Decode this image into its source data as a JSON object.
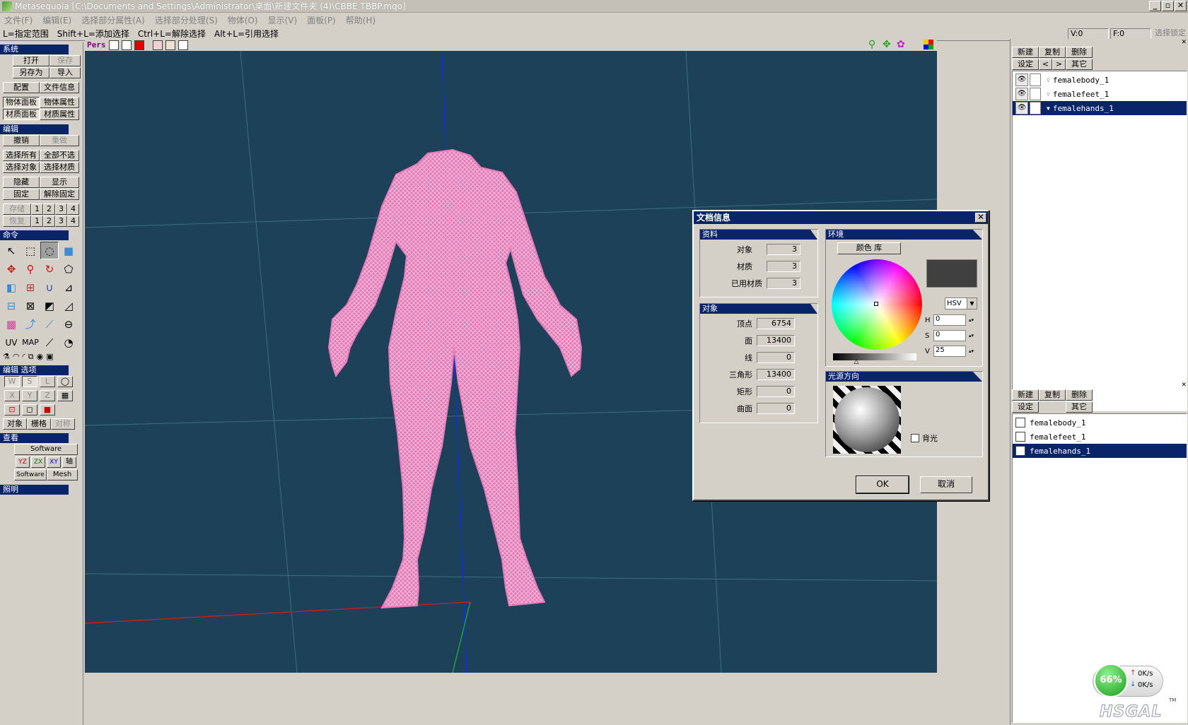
{
  "window": {
    "title": "Metasequoia [C:\\Documents and Settings\\Administrator\\桌面\\新建文件夹 (4)\\CBBE TBBP.mqo]"
  },
  "menu": [
    "文件(F)",
    "编辑(E)",
    "选择部分属性(A)",
    "选择部分处理(S)",
    "物体(O)",
    "显示(V)",
    "面板(P)",
    "帮助(H)"
  ],
  "hints": [
    "L=指定范围",
    "Shift+L=添加选择",
    "Ctrl+L=解除选择",
    "Alt+L=引用选择"
  ],
  "status": {
    "v": "V:0",
    "f": "F:0",
    "lock": "选择锁定"
  },
  "left": {
    "system_title": "系统",
    "open": "打开",
    "save": "保存",
    "save_as": "另存为",
    "import": "导入",
    "config": "配置",
    "file_info": "文件信息",
    "obj_panel": "物体面板",
    "obj_attr": "物体属性",
    "mat_panel": "材质面板",
    "mat_attr": "材质属性",
    "edit_title": "编辑",
    "undo": "撤销",
    "redo": "重做",
    "select_all": "选择所有",
    "deselect_all": "全部不选",
    "select_obj": "选择对象",
    "select_mat": "选择材质",
    "hide": "隐藏",
    "show": "显示",
    "fix": "固定",
    "unfix": "解除固定",
    "store": "存储",
    "restore": "恢复",
    "nums": [
      "1",
      "2",
      "3",
      "4"
    ],
    "cmd_title": "命令",
    "uv": "UV",
    "map": "MAP",
    "edit_opt_title": "编辑 选项",
    "w": "W",
    "s": "S",
    "l": "L",
    "x": "X",
    "y": "Y",
    "z": "Z",
    "object": "对象",
    "grid": "栅格",
    "symmetry": "对称",
    "view_title": "查看",
    "software": "Software",
    "yz": "YZ",
    "zx": "ZX",
    "xy": "XY",
    "axis": "轴",
    "software2": "Software",
    "mesh": "Mesh",
    "light_title": "照明"
  },
  "viewport": {
    "mode": "Pers"
  },
  "dialog": {
    "title": "文档信息",
    "data_title": "资料",
    "objects_label": "对象",
    "objects_val": "3",
    "materials_label": "材质",
    "materials_val": "3",
    "used_mat_label": "已用材质",
    "used_mat_val": "3",
    "obj_title": "对象",
    "vertex_label": "顶点",
    "vertex_val": "6754",
    "face_label": "面",
    "face_val": "13400",
    "line_label": "线",
    "line_val": "0",
    "tri_label": "三角形",
    "tri_val": "13400",
    "quad_label": "矩形",
    "quad_val": "0",
    "curve_label": "曲面",
    "curve_val": "0",
    "env_title": "环境",
    "color_lib": "颜色 库",
    "mode": "HSV",
    "h_label": "H",
    "h_val": "0",
    "s_label": "S",
    "s_val": "0",
    "v_label": "V",
    "v_val": "25",
    "light_title": "光源方向",
    "backlight": "背光",
    "ok": "OK",
    "cancel": "取消"
  },
  "obj_panel": {
    "new": "新建",
    "copy": "复制",
    "delete": "删除",
    "settings": "设定",
    "prev": "<",
    "next": ">",
    "other": "其它",
    "items": [
      "femalebody_1",
      "femalefeet_1",
      "femalehands_1"
    ]
  },
  "mat_panel": {
    "new": "新建",
    "copy": "复制",
    "delete": "删除",
    "settings": "设定",
    "other": "其它",
    "items": [
      "femalebody_1",
      "femalefeet_1",
      "femalehands_1"
    ]
  },
  "net": {
    "percent": "66%",
    "up": "0K/s",
    "down": "0K/s",
    "logo": "HSGAL",
    "tm": "TM"
  }
}
